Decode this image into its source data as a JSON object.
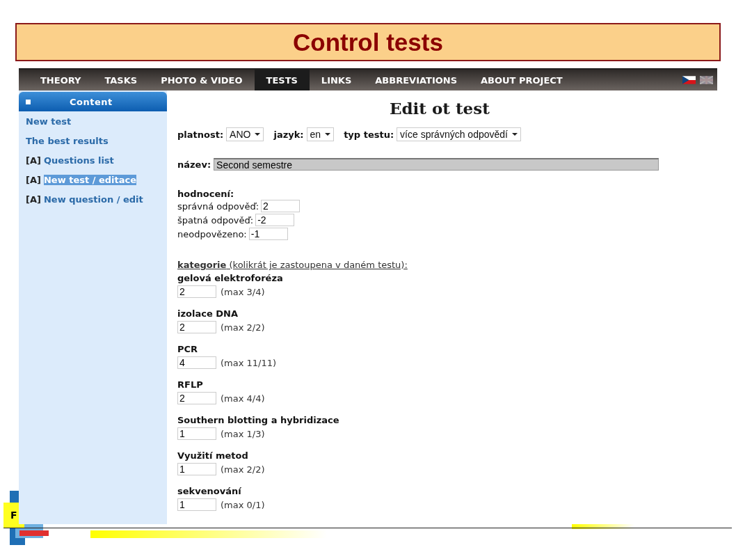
{
  "slide": {
    "title": "Control tests",
    "footer_fragment": "F"
  },
  "nav": {
    "items": [
      {
        "label": "THEORY",
        "selected": false
      },
      {
        "label": "TASKS",
        "selected": false
      },
      {
        "label": "PHOTO & VIDEO",
        "selected": false
      },
      {
        "label": "TESTS",
        "selected": true
      },
      {
        "label": "LINKS",
        "selected": false
      },
      {
        "label": "ABBREVIATIONS",
        "selected": false
      },
      {
        "label": "ABOUT PROJECT",
        "selected": false
      }
    ]
  },
  "sidebar": {
    "title": "Content",
    "items": [
      {
        "label": "New test",
        "selected": false
      },
      {
        "label": "The best results",
        "selected": false
      },
      {
        "prefix": "[A]",
        "label": "Questions list",
        "selected": false
      },
      {
        "prefix": "[A]",
        "label": "New test / editace",
        "selected": true
      },
      {
        "prefix": "[A]",
        "label": "New question / edit",
        "selected": false
      }
    ]
  },
  "page": {
    "title": "Edit ot test",
    "filters": [
      {
        "label": "platnost:",
        "value": "ANO"
      },
      {
        "label": "jazyk:",
        "value": "en"
      },
      {
        "label": "typ testu:",
        "value": "více správných odpovědí"
      }
    ],
    "name": {
      "label": "název:",
      "value": "Second semestre"
    },
    "scoring": {
      "title": "hodnocení:",
      "rows": [
        {
          "label": "správná odpověď:",
          "value": "2"
        },
        {
          "label": "špatná odpověď:",
          "value": "-2"
        },
        {
          "label": "neodpovězeno:",
          "value": "-1"
        }
      ]
    },
    "categories": {
      "heading": "**kategorie** (kolikrát je zastoupena v daném testu):",
      "items": [
        {
          "name": "gelová elektroforéza",
          "value": "2",
          "max": "(max 3/4)"
        },
        {
          "name": "izolace DNA",
          "value": "2",
          "max": "(max 2/2)"
        },
        {
          "name": "PCR",
          "value": "4",
          "max": "(max 11/11)"
        },
        {
          "name": "RFLP",
          "value": "2",
          "max": "(max 4/4)"
        },
        {
          "name": "Southern blotting a hybridizace",
          "value": "1",
          "max": "(max 1/3)"
        },
        {
          "name": "Využití metod",
          "value": "1",
          "max": "(max 2/2)"
        },
        {
          "name": "sekvenování",
          "value": "1",
          "max": "(max 0/1)"
        }
      ]
    }
  }
}
